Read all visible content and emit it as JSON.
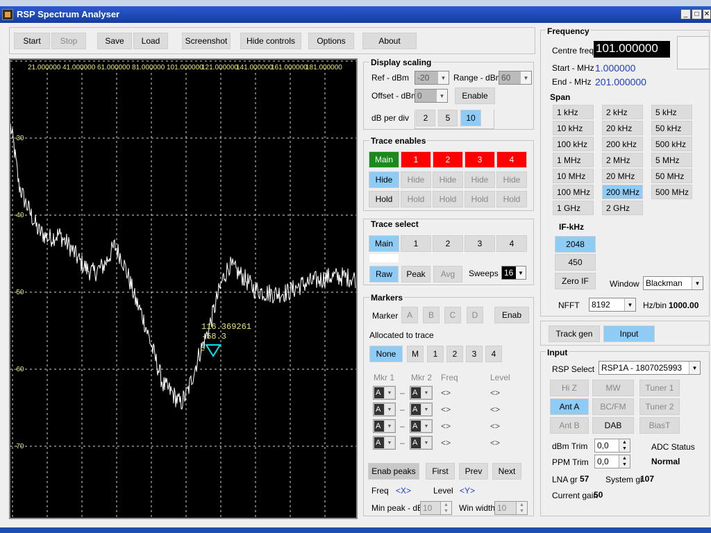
{
  "window": {
    "title": "RSP Spectrum Analyser",
    "minimize": "_",
    "maximize": "□",
    "close": "✕"
  },
  "toolbar": {
    "start": "Start",
    "stop": "Stop",
    "save": "Save",
    "load": "Load",
    "screenshot": "Screenshot",
    "hide_controls": "Hide controls",
    "options": "Options",
    "about": "About"
  },
  "plot": {
    "freq_labels": [
      "21.000000",
      "41.000000",
      "61.000000",
      "81.000000",
      "101.000000",
      "121.000000",
      "141.000000",
      "161.000000",
      "181.000000"
    ],
    "level_labels": [
      "-30",
      "-40",
      "-50",
      "-60",
      "-70"
    ],
    "marker_freq": "116.369261",
    "marker_level": "-58.3",
    "marker_tag": "F",
    "bg_color": "#000000",
    "grid_color": "#ffffff",
    "trace_color": "#ffffff",
    "marker_color": "#00e5ee",
    "label_color": "#e8e870"
  },
  "display_scaling": {
    "title": "Display scaling",
    "ref_label": "Ref - dBm",
    "ref_value": "-20",
    "range_label": "Range - dBm",
    "range_value": "60",
    "offset_label": "Offset - dBm",
    "offset_value": "0",
    "enable": "Enable",
    "db_per_div_label": "dB per div",
    "db_options": [
      "2",
      "5",
      "10"
    ]
  },
  "trace_enables": {
    "title": "Trace enables",
    "traces": [
      "Main",
      "1",
      "2",
      "3",
      "4"
    ],
    "hide": "Hide",
    "hold": "Hold"
  },
  "trace_select": {
    "title": "Trace select",
    "traces": [
      "Main",
      "1",
      "2",
      "3",
      "4"
    ],
    "modes": [
      "Raw",
      "Peak",
      "Avg"
    ],
    "sweeps_label": "Sweeps",
    "sweeps_value": "16"
  },
  "markers": {
    "title": "Markers",
    "marker_label": "Marker",
    "letters": [
      "A",
      "B",
      "C",
      "D"
    ],
    "enab": "Enab",
    "allocated_label": "Allocated to trace",
    "alloc": [
      "None",
      "M",
      "1",
      "2",
      "3",
      "4"
    ],
    "col_mkr1": "Mkr 1",
    "col_mkr2": "Mkr 2",
    "col_freq": "Freq",
    "col_level": "Level",
    "rows": [
      {
        "m1": "A",
        "dash": "–",
        "m2": "A",
        "freq": "<>",
        "level": "<>"
      },
      {
        "m1": "A",
        "dash": "–",
        "m2": "A",
        "freq": "<>",
        "level": "<>"
      },
      {
        "m1": "A",
        "dash": "–",
        "m2": "A",
        "freq": "<>",
        "level": "<>"
      },
      {
        "m1": "A",
        "dash": "–",
        "m2": "A",
        "freq": "<>",
        "level": "<>"
      }
    ],
    "enab_peaks": "Enab peaks",
    "first": "First",
    "prev": "Prev",
    "next": "Next",
    "freq_label": "Freq",
    "freq_val": "<X>",
    "level_label": "Level",
    "level_val": "<Y>",
    "min_peak_label": "Min peak - dB",
    "min_peak_value": "10",
    "win_width_label": "Win width",
    "win_width_value": "10"
  },
  "frequency": {
    "title": "Frequency",
    "centre_label": "Centre freq",
    "centre_value": "101.000000",
    "start_label": "Start - MHz",
    "start_value": "1.000000",
    "end_label": "End - MHz",
    "end_value": "201.000000",
    "span_title": "Span",
    "span": [
      [
        "1 kHz",
        "2 kHz",
        "5 kHz"
      ],
      [
        "10 kHz",
        "20 kHz",
        "50 kHz"
      ],
      [
        "100 kHz",
        "200 kHz",
        "500 kHz"
      ],
      [
        "1 MHz",
        "2 MHz",
        "5 MHz"
      ],
      [
        "10 MHz",
        "20 MHz",
        "50 MHz"
      ],
      [
        "100 MHz",
        "200 MHz",
        "500 MHz"
      ],
      [
        "1 GHz",
        "2 GHz"
      ]
    ],
    "if_title": "IF-kHz",
    "if_options": [
      "2048",
      "450",
      "Zero IF"
    ],
    "window_label": "Window",
    "window_value": "Blackman",
    "nfft_label": "NFFT",
    "nfft_value": "8192",
    "hzbin_label": "Hz/bin",
    "hzbin_value": "1000.00"
  },
  "tabs": {
    "track_gen": "Track gen",
    "input": "Input"
  },
  "input": {
    "title": "Input",
    "rsp_select_label": "RSP Select",
    "rsp_select_value": "RSP1A - 1807025993",
    "buttons": [
      [
        "Hi Z",
        "MW",
        "Tuner 1"
      ],
      [
        "Ant A",
        "BC/FM",
        "Tuner 2"
      ],
      [
        "Ant B",
        "DAB",
        "BiasT"
      ]
    ],
    "dbm_trim_label": "dBm Trim",
    "dbm_trim_value": "0,0",
    "ppm_trim_label": "PPM Trim",
    "ppm_trim_value": "0,0",
    "adc_status_label": "ADC Status",
    "adc_status_value": "Normal",
    "lna_label": "LNA gr",
    "lna_value": "57",
    "system_label": "System gr",
    "system_value": "107",
    "current_gain_label": "Current gain",
    "current_gain_value": "50"
  }
}
